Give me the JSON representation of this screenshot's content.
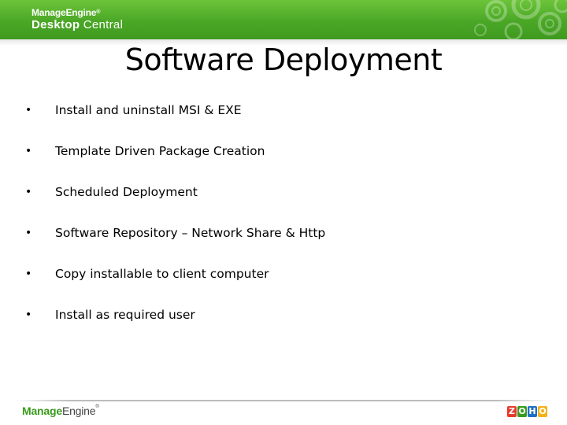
{
  "header": {
    "logo_top": "ManageEngine",
    "logo_reg": "®",
    "logo_bottom_bold": "Desktop",
    "logo_bottom_rest": " Central",
    "bar_color": "#4aa726"
  },
  "slide": {
    "title": "Software Deployment",
    "bullet_glyph": "•",
    "bullets": [
      "Install and uninstall MSI & EXE",
      "Template Driven Package Creation",
      "Scheduled Deployment",
      "Software Repository – Network Share & Http",
      "Copy installable to client computer",
      "Install as required user"
    ]
  },
  "footer": {
    "logo_part1": "Manage",
    "logo_part2": "Engine",
    "logo_reg": "®",
    "zoho_letters": [
      "Z",
      "O",
      "H",
      "O"
    ],
    "zoho_colors": [
      "#e53b2c",
      "#3a9b1e",
      "#1f6fc5",
      "#f2b31b"
    ]
  }
}
